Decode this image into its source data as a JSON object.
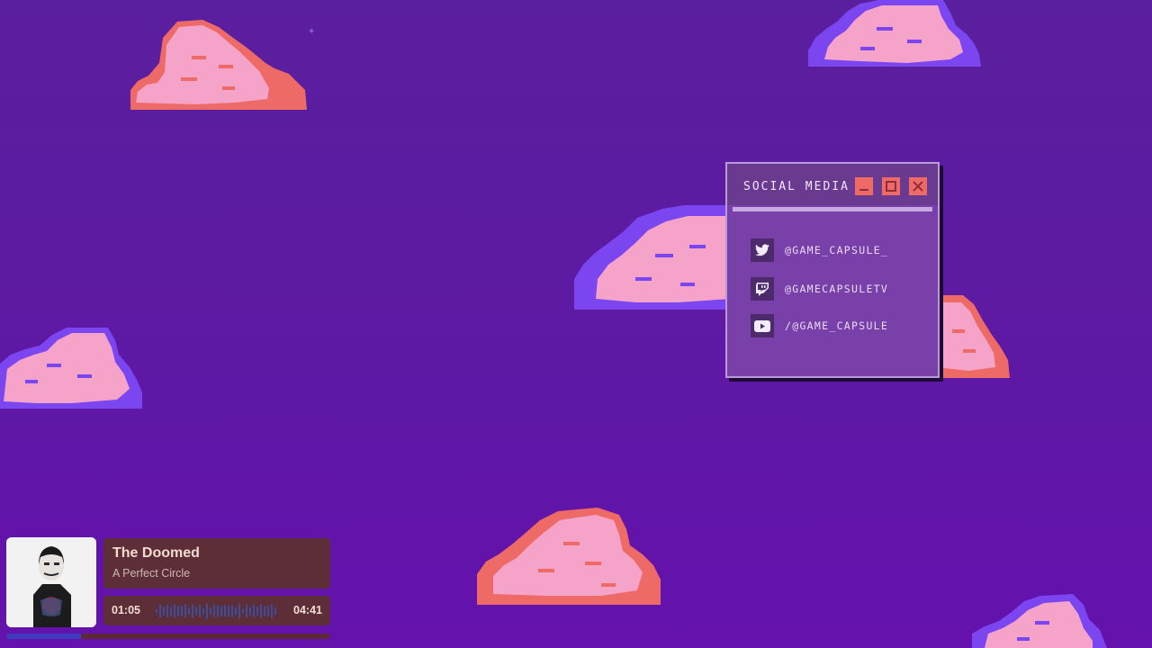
{
  "social_window": {
    "title": "SOCIAL MEDIA",
    "accounts": [
      {
        "icon": "twitter-icon",
        "handle": "@GAME_CAPSULE_"
      },
      {
        "icon": "twitch-icon",
        "handle": "@GAMECAPSULETV"
      },
      {
        "icon": "youtube-icon",
        "handle": "/@GAME_CAPSULE"
      }
    ]
  },
  "now_playing": {
    "title": "The Doomed",
    "artist": "A Perfect Circle",
    "elapsed": "01:05",
    "duration": "04:41",
    "progress_fraction": 0.23
  },
  "colors": {
    "background": "#5e19a4",
    "cloud_pink": "#f5a3c9",
    "cloud_coral": "#ee6a67",
    "cloud_violet": "#7b45f0",
    "window_bg": "#7840a8",
    "window_button": "#ee6a67",
    "player_panel": "#5e2e38",
    "progress_fill": "#3e3bbf"
  }
}
